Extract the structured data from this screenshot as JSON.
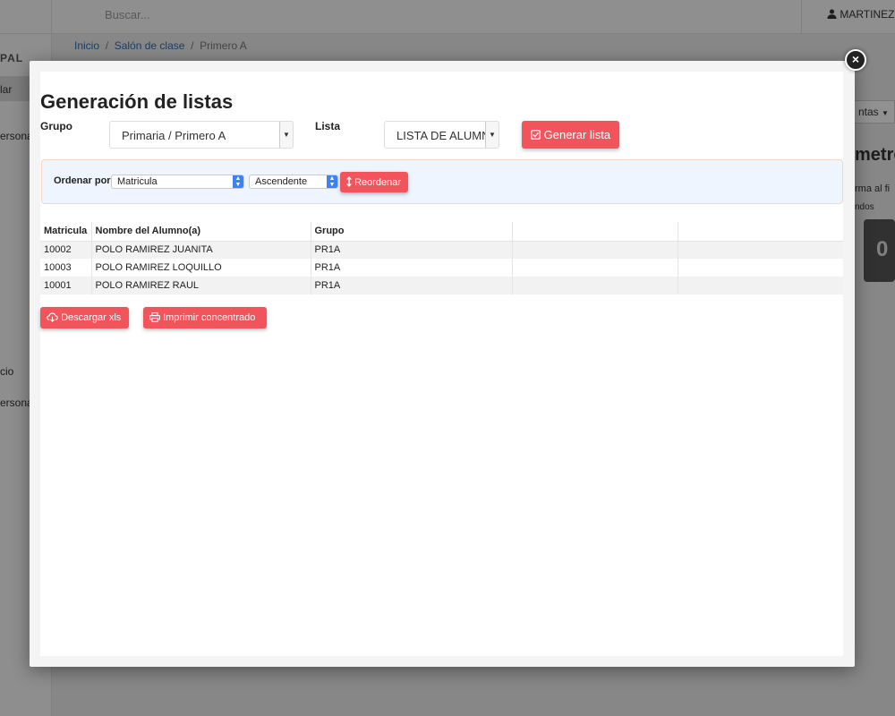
{
  "background": {
    "search_placeholder": "Buscar...",
    "user_name": "MARTINEZ R",
    "sidebar": {
      "section_title": "PAL",
      "items": [
        "lar",
        "ersonal",
        "cio",
        "ersonal"
      ]
    },
    "breadcrumb": {
      "items": [
        "Inicio",
        "Salón de clase",
        "Primero A"
      ],
      "separator": "/"
    },
    "right_button_label": "ntas",
    "right_title": "metro",
    "right_text_1": "rma al fi",
    "right_text_2": "ndos",
    "right_panel_value": "0"
  },
  "modal": {
    "title": "Generación de listas",
    "close_glyph": "×",
    "grupo_label": "Grupo",
    "grupo_value": "Primaria / Primero A",
    "lista_label": "Lista",
    "lista_value": "LISTA DE ALUMNOS",
    "generate_label": "Generar lista",
    "sort": {
      "label": "Ordenar por",
      "field_value": "Matricula",
      "order_value": "Ascendente",
      "reorder_label": "Reordenar"
    },
    "table": {
      "headers": [
        "Matricula",
        "Nombre del Alumno(a)",
        "Grupo",
        "",
        ""
      ],
      "rows": [
        [
          "10002",
          "POLO RAMIREZ JUANITA",
          "PR1A",
          "",
          ""
        ],
        [
          "10003",
          "POLO RAMIREZ LOQUILLO",
          "PR1A",
          "",
          ""
        ],
        [
          "10001",
          "POLO RAMIREZ RAUL",
          "PR1A",
          "",
          ""
        ]
      ]
    },
    "download_label": "Descargar xls",
    "print_label": "Imprimir concentrado"
  },
  "colors": {
    "accent_red": "#f2545b",
    "sort_panel_bg": "#eef5fe",
    "select_caret_blue": "#3b82f6"
  },
  "icons": {
    "user": "user-icon",
    "close": "close-icon",
    "checkbox": "check-square-icon",
    "sort": "sort-arrows-icon",
    "download": "cloud-download-icon",
    "print": "printer-icon"
  }
}
